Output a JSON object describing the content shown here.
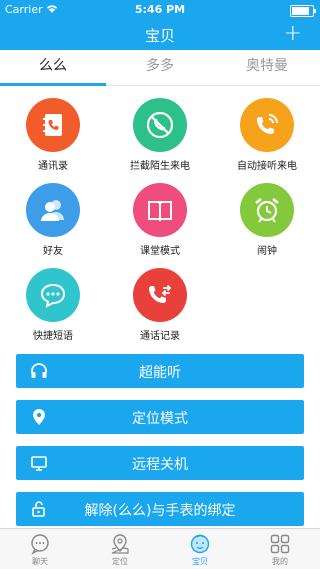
{
  "status": {
    "carrier": "Carrier",
    "time": "5:46 PM",
    "battery_level": 0.85
  },
  "nav": {
    "title": "宝贝",
    "add_label": "+"
  },
  "tabs": [
    {
      "label": "么么",
      "active": true
    },
    {
      "label": "多多",
      "active": false
    },
    {
      "label": "奥特曼",
      "active": false
    }
  ],
  "grid": [
    {
      "label": "通讯录",
      "icon": "address-book-icon",
      "color": "#f25b2a"
    },
    {
      "label": "拦截陌生来电",
      "icon": "block-call-icon",
      "color": "#2dc08a"
    },
    {
      "label": "自动接听来电",
      "icon": "auto-answer-icon",
      "color": "#f7a21b"
    },
    {
      "label": "好友",
      "icon": "friends-icon",
      "color": "#3d9de8"
    },
    {
      "label": "课堂模式",
      "icon": "book-icon",
      "color": "#ee4d7e"
    },
    {
      "label": "闹钟",
      "icon": "alarm-clock-icon",
      "color": "#84c83c"
    },
    {
      "label": "快捷短语",
      "icon": "chat-bubble-icon",
      "color": "#30c4cc"
    },
    {
      "label": "通话记录",
      "icon": "call-log-icon",
      "color": "#e8413c"
    }
  ],
  "actions": [
    {
      "label": "超能听",
      "icon": "headphones-icon"
    },
    {
      "label": "定位模式",
      "icon": "location-pin-icon"
    },
    {
      "label": "远程关机",
      "icon": "monitor-icon"
    },
    {
      "label": "解除(么么)与手表的绑定",
      "icon": "unlock-icon"
    }
  ],
  "bottom": [
    {
      "label": "聊天",
      "icon": "chat-tab-icon",
      "active": false
    },
    {
      "label": "定位",
      "icon": "map-pin-tab-icon",
      "active": false
    },
    {
      "label": "宝贝",
      "icon": "baby-face-tab-icon",
      "active": true
    },
    {
      "label": "我的",
      "icon": "grid-tab-icon",
      "active": false
    }
  ],
  "colors": {
    "accent": "#1aa7ee"
  }
}
